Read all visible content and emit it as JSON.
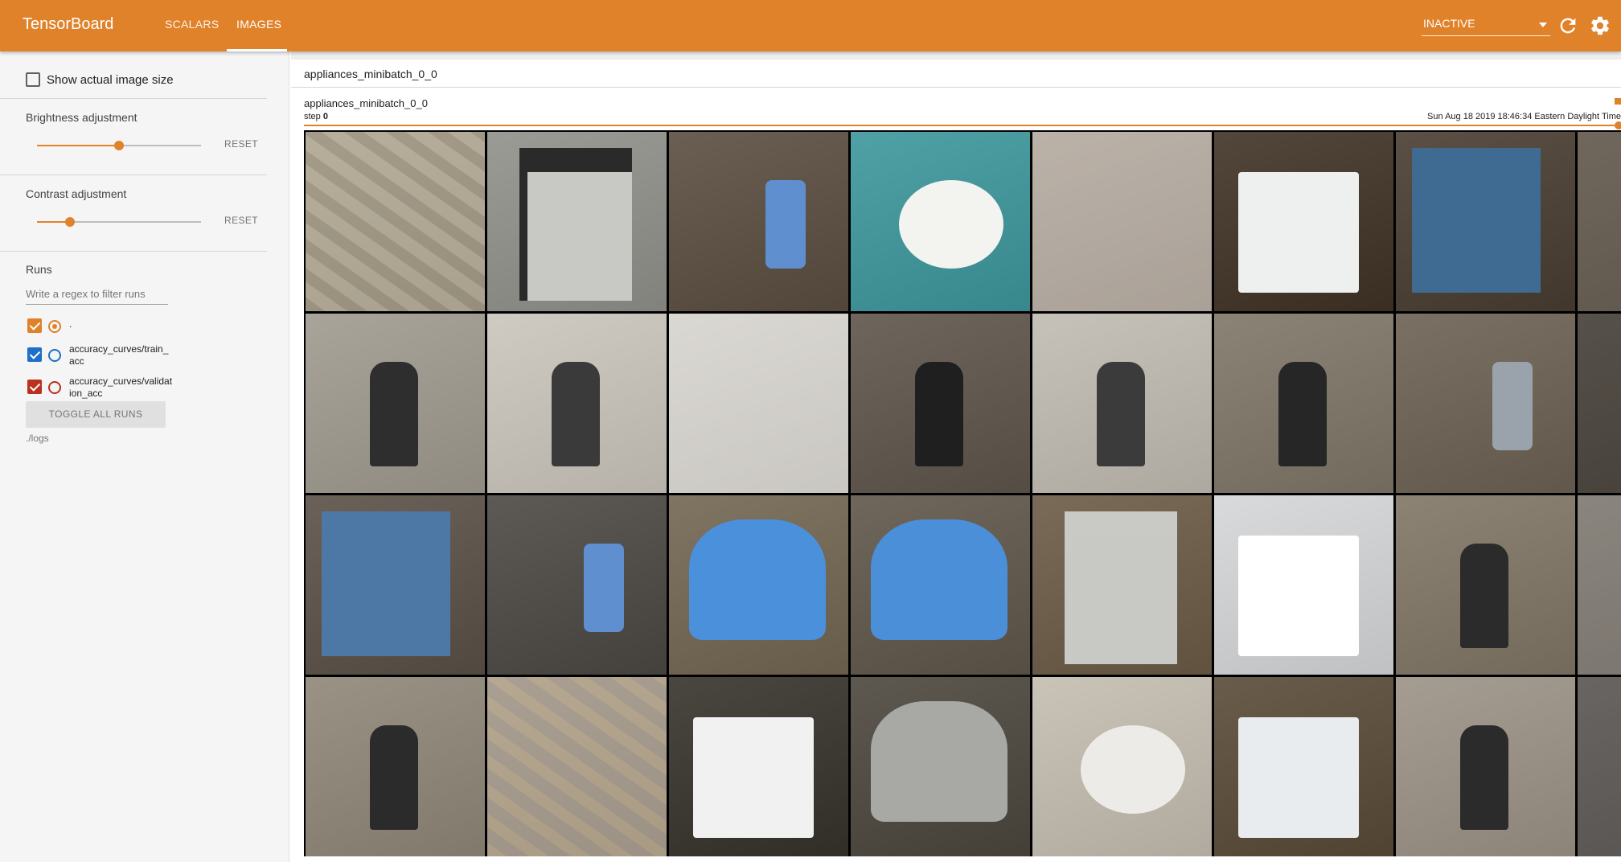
{
  "app": {
    "title": "TensorBoard",
    "accent_color": "#e0822a"
  },
  "tabs": [
    {
      "label": "SCALARS",
      "active": false
    },
    {
      "label": "IMAGES",
      "active": true
    }
  ],
  "toolbar": {
    "run_select_value": "INACTIVE",
    "reload_icon": "refresh-icon",
    "settings_icon": "gear-icon"
  },
  "sidebar": {
    "show_actual_size": {
      "label": "Show actual image size",
      "checked": false
    },
    "brightness": {
      "title": "Brightness adjustment",
      "value": 0.5,
      "reset_label": "RESET"
    },
    "contrast": {
      "title": "Contrast adjustment",
      "value": 0.2,
      "reset_label": "RESET"
    },
    "runs": {
      "title": "Runs",
      "filter_placeholder": "Write a regex to filter runs",
      "items": [
        {
          "name": ".",
          "checked": true,
          "color": "#e0822a",
          "selected": true
        },
        {
          "name": "accuracy_curves/train_acc",
          "checked": true,
          "color": "#1e6fc8",
          "selected": false
        },
        {
          "name": "accuracy_curves/validation_acc",
          "checked": true,
          "color": "#b8321f",
          "selected": false
        }
      ],
      "toggle_all_label": "TOGGLE ALL RUNS",
      "log_dir": "./logs"
    }
  },
  "main": {
    "tag_header": "appliances_minibatch_0_0",
    "card": {
      "tag": "appliances_minibatch_0_0",
      "step_label": "step",
      "step_value": "0",
      "timestamp": "Sun Aug 18 2019 18:46:34 Eastern Daylight Time"
    }
  },
  "image_grid": {
    "tiles": [
      {
        "subject": "stone wall",
        "bg": "#b7ae9c",
        "fg": "#8e8573",
        "shape": "wall"
      },
      {
        "subject": "electrical panel",
        "bg": "#9b9b96",
        "fg": "#2a2a2a",
        "shape": "panel"
      },
      {
        "subject": "water filter",
        "bg": "#6a5f52",
        "fg": "#5f8fcf",
        "shape": "filter"
      },
      {
        "subject": "smoke detector",
        "bg": "#4fa1a6",
        "fg": "#f3f3f0",
        "shape": "disc"
      },
      {
        "subject": "plain wall",
        "bg": "#bfb6ad",
        "fg": "#b2a99f",
        "shape": "plain"
      },
      {
        "subject": "washing machine",
        "bg": "#53463a",
        "fg": "#eef0f0",
        "shape": "box"
      },
      {
        "subject": "boiler",
        "bg": "#5b5045",
        "fg": "#3f6a91",
        "shape": "boiler"
      },
      {
        "subject": "partial",
        "bg": "#7a7066",
        "fg": "#5a524a",
        "shape": "plain"
      },
      {
        "subject": "sump pump",
        "bg": "#a9a49a",
        "fg": "#2e2e2e",
        "shape": "pump"
      },
      {
        "subject": "sump pump",
        "bg": "#cfcbc3",
        "fg": "#3a3a3a",
        "shape": "pump"
      },
      {
        "subject": "white wall",
        "bg": "#e2e0db",
        "fg": "#c9c6bf",
        "shape": "plain"
      },
      {
        "subject": "pump motor",
        "bg": "#6e665c",
        "fg": "#1f1f1f",
        "shape": "pump"
      },
      {
        "subject": "sump pump",
        "bg": "#c6c2b9",
        "fg": "#3b3b3b",
        "shape": "pump"
      },
      {
        "subject": "floor pump",
        "bg": "#8b8376",
        "fg": "#262626",
        "shape": "pump"
      },
      {
        "subject": "water heater",
        "bg": "#7b7064",
        "fg": "#9aa3ab",
        "shape": "filter"
      },
      {
        "subject": "partial",
        "bg": "#5c564f",
        "fg": "#4a453f",
        "shape": "plain"
      },
      {
        "subject": "boiler",
        "bg": "#6a6259",
        "fg": "#4d78a6",
        "shape": "boiler"
      },
      {
        "subject": "water heater",
        "bg": "#5d5a56",
        "fg": "#5f8fcf",
        "shape": "filter"
      },
      {
        "subject": "pressure tank",
        "bg": "#807463",
        "fg": "#4b90db",
        "shape": "tank"
      },
      {
        "subject": "pressure tank",
        "bg": "#6f675c",
        "fg": "#4b8fd9",
        "shape": "tank"
      },
      {
        "subject": "electrical panel",
        "bg": "#7a6a58",
        "fg": "#c9c9c6",
        "shape": "panel"
      },
      {
        "subject": "appliance top",
        "bg": "#d9dadb",
        "fg": "#ffffff",
        "shape": "box"
      },
      {
        "subject": "sump pump",
        "bg": "#8d8374",
        "fg": "#2b2b2b",
        "shape": "pump"
      },
      {
        "subject": "partial",
        "bg": "#6c665f",
        "fg": "#d0ccc6",
        "shape": "plain"
      },
      {
        "subject": "sump pump",
        "bg": "#9a9284",
        "fg": "#2b2b2b",
        "shape": "pump"
      },
      {
        "subject": "wood beam",
        "bg": "#a99f92",
        "fg": "#c7b48f",
        "shape": "wall"
      },
      {
        "subject": "washer dryer",
        "bg": "#4a4640",
        "fg": "#f1f1f1",
        "shape": "box"
      },
      {
        "subject": "oil tank",
        "bg": "#5d5850",
        "fg": "#a8a9a4",
        "shape": "tank"
      },
      {
        "subject": "smoke detector",
        "bg": "#c9c3b8",
        "fg": "#ecebe8",
        "shape": "disc"
      },
      {
        "subject": "washing machine",
        "bg": "#6a5c4b",
        "fg": "#e8ecee",
        "shape": "box"
      },
      {
        "subject": "sump pump",
        "bg": "#a59d91",
        "fg": "#2b2b2b",
        "shape": "pump"
      },
      {
        "subject": "partial",
        "bg": "#6d6a66",
        "fg": "#5e5b58",
        "shape": "plain"
      }
    ]
  }
}
